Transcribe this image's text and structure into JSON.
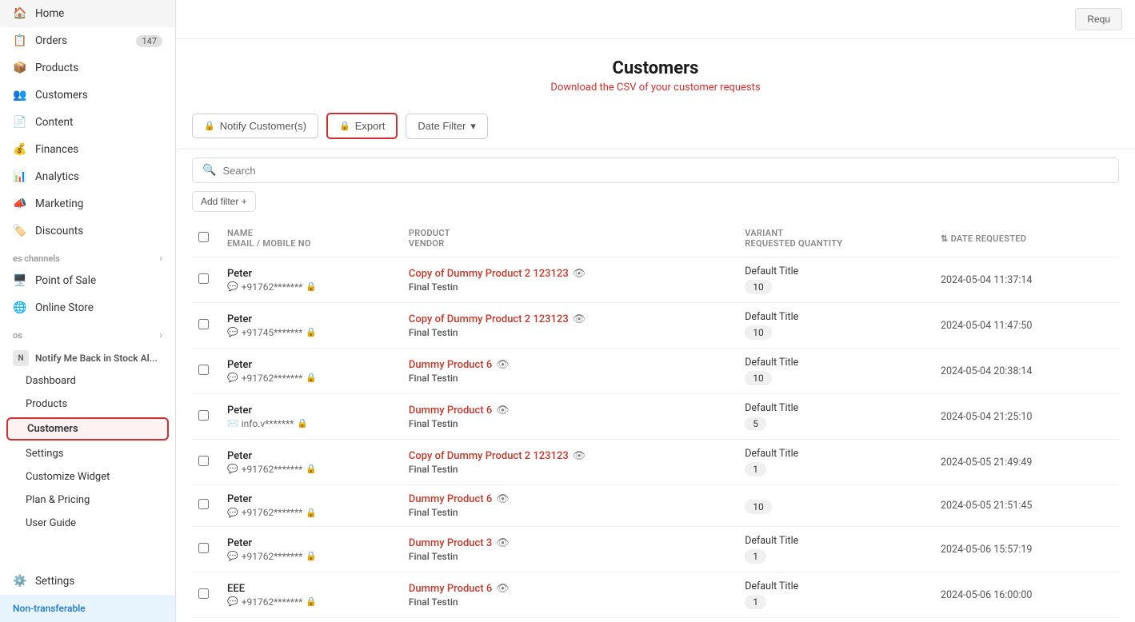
{
  "sidebar": {
    "items": [
      {
        "label": "Home",
        "icon": "🏠",
        "badge": null
      },
      {
        "label": "Orders",
        "icon": "📋",
        "badge": "147"
      },
      {
        "label": "Products",
        "icon": "📦",
        "badge": null
      },
      {
        "label": "Customers",
        "icon": "👥",
        "badge": null
      },
      {
        "label": "Content",
        "icon": "📄",
        "badge": null
      },
      {
        "label": "Finances",
        "icon": "💰",
        "badge": null
      },
      {
        "label": "Analytics",
        "icon": "📊",
        "badge": null
      },
      {
        "label": "Marketing",
        "icon": "📣",
        "badge": null
      },
      {
        "label": "Discounts",
        "icon": "🏷️",
        "badge": null
      }
    ],
    "sales_channels_label": "es channels",
    "sales_channels": [
      {
        "label": "Point of Sale",
        "icon": "🖥️"
      },
      {
        "label": "Online Store",
        "icon": "🌐"
      }
    ],
    "apps_label": "os",
    "app_name": "Notify Me Back in Stock Al...",
    "app_sub_items": [
      {
        "label": "Dashboard"
      },
      {
        "label": "Products"
      },
      {
        "label": "Customers",
        "active": true
      },
      {
        "label": "Settings"
      },
      {
        "label": "Customize Widget"
      },
      {
        "label": "Plan & Pricing"
      },
      {
        "label": "User Guide"
      }
    ],
    "bottom_items": [
      {
        "label": "Settings",
        "icon": "⚙️"
      }
    ],
    "non_transferable": "Non-transferable"
  },
  "page": {
    "title": "Customers",
    "subtitle": "Download the CSV of your customer requests",
    "top_bar_button": "Requ",
    "toolbar": {
      "notify_btn": "Notify Customer(s)",
      "export_btn": "Export",
      "date_filter_btn": "Date Filter"
    },
    "search_placeholder": "Search",
    "add_filter_btn": "Add filter +"
  },
  "table": {
    "columns": [
      {
        "label": "NAME\nEMAIL / MOBILE NO"
      },
      {
        "label": "PRODUCT\nVENDOR"
      },
      {
        "label": "VARIANT\nREQUESTED QUANTITY"
      },
      {
        "label": "DATE REQUESTED",
        "sortable": true
      }
    ],
    "rows": [
      {
        "name": "Peter",
        "contact": "+91762*******",
        "contact_type": "phone",
        "product": "Copy of Dummy Product 2 123123",
        "vendor": "Final Testin",
        "variant": "Default Title",
        "qty": "10",
        "date": "2024-05-04 11:37:14"
      },
      {
        "name": "Peter",
        "contact": "+91745*******",
        "contact_type": "phone",
        "product": "Copy of Dummy Product 2 123123",
        "vendor": "Final Testin",
        "variant": "Default Title",
        "qty": "10",
        "date": "2024-05-04 11:47:50"
      },
      {
        "name": "Peter",
        "contact": "+91762*******",
        "contact_type": "phone",
        "product": "Dummy Product 6",
        "vendor": "Final Testin",
        "variant": "Default Title",
        "qty": "10",
        "date": "2024-05-04 20:38:14"
      },
      {
        "name": "Peter",
        "contact": "info.v*******",
        "contact_type": "email",
        "product": "Dummy Product 6",
        "vendor": "Final Testin",
        "variant": "Default Title",
        "qty": "5",
        "date": "2024-05-04 21:25:10"
      },
      {
        "name": "Peter",
        "contact": "+91762*******",
        "contact_type": "phone",
        "product": "Copy of Dummy Product 2 123123",
        "vendor": "Final Testin",
        "variant": "Default Title",
        "qty": "1",
        "date": "2024-05-05 21:49:49"
      },
      {
        "name": "Peter",
        "contact": "+91762*******",
        "contact_type": "phone",
        "product": "Dummy Product 6",
        "vendor": "Final Testin",
        "variant": null,
        "qty": "10",
        "date": "2024-05-05 21:51:45"
      },
      {
        "name": "Peter",
        "contact": "+91762*******",
        "contact_type": "phone",
        "product": "Dummy Product 3",
        "vendor": "Final Testin",
        "variant": "Default Title",
        "qty": "1",
        "date": "2024-05-06 15:57:19"
      },
      {
        "name": "EEE",
        "contact": "+91762*******",
        "contact_type": "phone",
        "product": "Dummy Product 6",
        "vendor": "Final Testin",
        "variant": "Default Title",
        "qty": "1",
        "date": "2024-05-06 16:00:00"
      }
    ]
  }
}
